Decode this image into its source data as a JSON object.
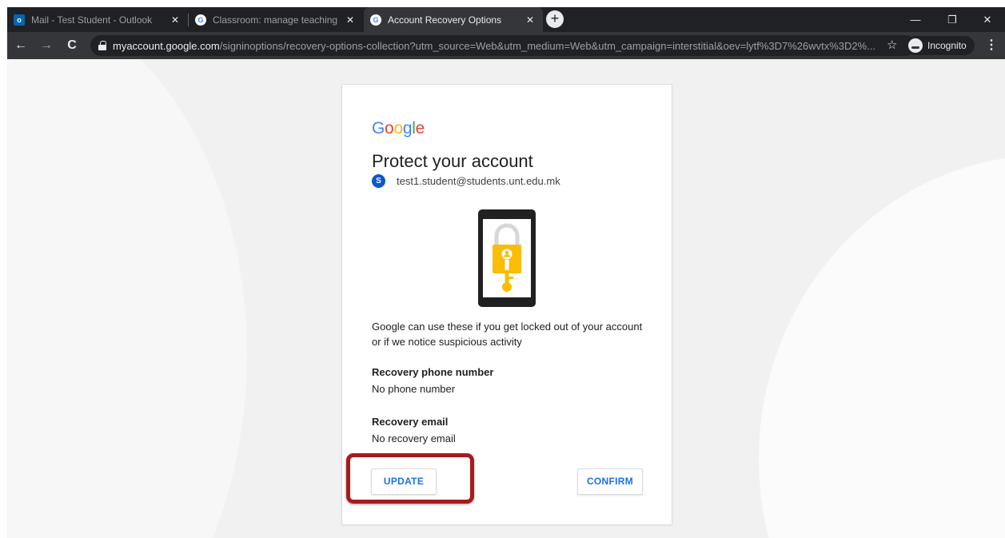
{
  "browser": {
    "tabs": [
      {
        "title": "Mail - Test Student - Outlook",
        "icon": "outlook-icon",
        "active": false
      },
      {
        "title": "Classroom: manage teaching and",
        "icon": "google-g-icon",
        "active": false
      },
      {
        "title": "Account Recovery Options",
        "icon": "google-g-icon",
        "active": true
      }
    ],
    "new_tab_label": "+",
    "close_label": "✕",
    "url_host": "myaccount.google.com",
    "url_path": "/signinoptions/recovery-options-collection?utm_source=Web&utm_medium=Web&utm_campaign=interstitial&oev=lytf%3D7%26wvtx%3D2%...",
    "incognito_label": "Incognito",
    "window": {
      "minimize": "—",
      "restore": "❐",
      "close": "✕"
    },
    "nav": {
      "back": "←",
      "forward": "→",
      "reload": "C",
      "star": "☆",
      "menu": "⋮"
    }
  },
  "card": {
    "logo": [
      "G",
      "o",
      "o",
      "g",
      "l",
      "e"
    ],
    "logo_colors": [
      "#4285f4",
      "#ea4335",
      "#fbbc05",
      "#4285f4",
      "#34a853",
      "#ea4335"
    ],
    "title": "Protect your account",
    "avatar_letter": "S",
    "email": "test1.student@students.unt.edu.mk",
    "intro": "Google can use these if you get locked out of your account or if we notice suspicious activity",
    "phone_label": "Recovery phone number",
    "phone_value": "No phone number",
    "email_label": "Recovery email",
    "email_value": "No recovery email",
    "update_button": "UPDATE",
    "confirm_button": "CONFIRM"
  },
  "colors": {
    "accent": "#1a73e8",
    "highlight": "#a81b1b",
    "lock_yellow": "#fbbc04"
  }
}
